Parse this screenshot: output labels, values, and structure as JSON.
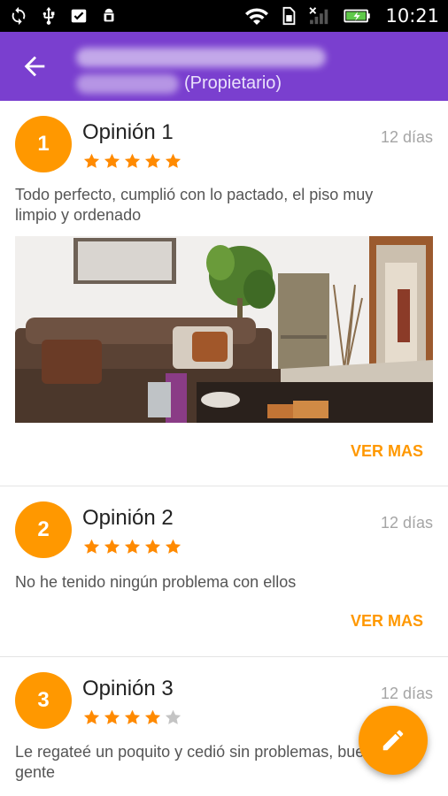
{
  "status_bar": {
    "time": "10:21",
    "icons": [
      "sync-icon",
      "usb-icon",
      "download-done-icon",
      "android-debug-icon",
      "wifi-icon",
      "sim-icon",
      "signal-icon",
      "battery-charging-icon"
    ]
  },
  "header": {
    "back_icon": "arrow-back-icon",
    "role": "(Propietario)"
  },
  "reviews": [
    {
      "number": "1",
      "title": "Opinión 1",
      "date": "12 días",
      "rating": 5,
      "text": "Todo perfecto, cumplió con lo pactado, el piso muy limpio y ordenado",
      "has_photo": true,
      "more_label": "VER MAS"
    },
    {
      "number": "2",
      "title": "Opinión 2",
      "date": "12 días",
      "rating": 5,
      "text": "No he tenido ningún problema con ellos",
      "has_photo": false,
      "more_label": "VER MAS"
    },
    {
      "number": "3",
      "title": "Opinión 3",
      "date": "12 días",
      "rating": 4,
      "text": "Le regateé un poquito y cedió sin problemas, buena gente",
      "has_photo": false,
      "more_label": ""
    }
  ],
  "fab": {
    "icon": "edit-pencil-icon"
  },
  "colors": {
    "app_bar": "#7a3fcf",
    "accent": "#ff9800",
    "star_filled": "#ff8a00",
    "star_empty": "#c4c4c4"
  }
}
